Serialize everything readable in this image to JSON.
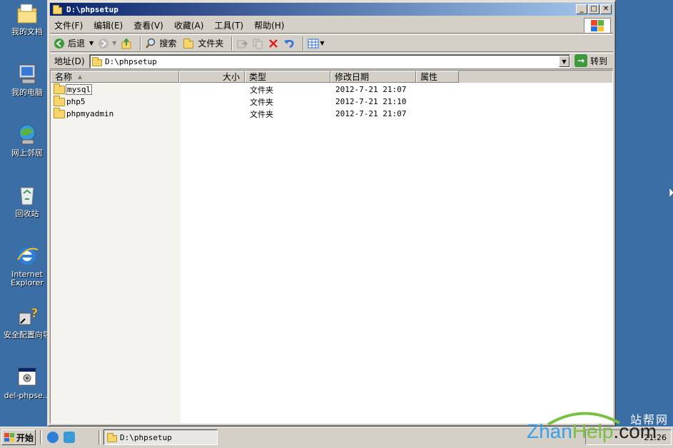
{
  "desktop": {
    "icons": [
      {
        "label": "我的文档"
      },
      {
        "label": "我的电脑"
      },
      {
        "label": "网上邻居"
      },
      {
        "label": "回收站"
      },
      {
        "label": "Internet Explorer"
      },
      {
        "label": "安全配置向导"
      },
      {
        "label": "del-phpse..."
      }
    ]
  },
  "window": {
    "title": "D:\\phpsetup",
    "menu": [
      "文件(F)",
      "编辑(E)",
      "查看(V)",
      "收藏(A)",
      "工具(T)",
      "帮助(H)"
    ],
    "toolbar": {
      "back_label": "后退",
      "search_label": "搜索",
      "folders_label": "文件夹"
    },
    "address": {
      "label": "地址(D)",
      "value": "D:\\phpsetup",
      "go_label": "转到"
    },
    "columns": {
      "name": "名称",
      "size": "大小",
      "type": "类型",
      "modified": "修改日期",
      "attributes": "属性"
    },
    "files": [
      {
        "name": "mysql",
        "size": "",
        "type": "文件夹",
        "modified": "2012-7-21 21:07",
        "attributes": ""
      },
      {
        "name": "php5",
        "size": "",
        "type": "文件夹",
        "modified": "2012-7-21 21:10",
        "attributes": ""
      },
      {
        "name": "phpmyadmin",
        "size": "",
        "type": "文件夹",
        "modified": "2012-7-21 21:07",
        "attributes": ""
      }
    ]
  },
  "taskbar": {
    "start_label": "开始",
    "task_item": "D:\\phpsetup",
    "clock": "21:26"
  },
  "watermark": {
    "cn": "站帮网",
    "en_1": "Zhan",
    "en_2": "Help",
    "en_3": ".com"
  },
  "colors": {
    "desktop": "#3a6ea5",
    "title_start": "#0a246a",
    "title_end": "#a6caf0",
    "face": "#d4d0c8"
  }
}
